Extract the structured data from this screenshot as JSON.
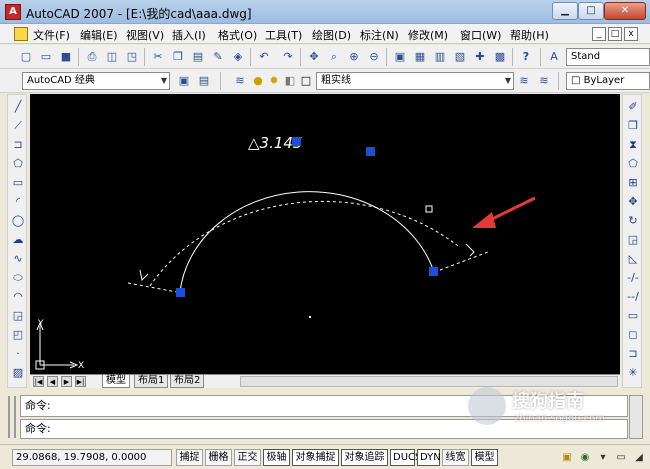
{
  "window": {
    "title": "AutoCAD 2007 - [E:\\我的cad\\aaa.dwg]",
    "min_glyph": "▁",
    "max_glyph": "□",
    "close_glyph": "✕"
  },
  "menu": {
    "items": [
      "文件(F)",
      "编辑(E)",
      "视图(V)",
      "插入(I)",
      "格式(O)",
      "工具(T)",
      "绘图(D)",
      "标注(N)",
      "修改(M)",
      "窗口(W)",
      "帮助(H)"
    ],
    "doc_controls": [
      "_",
      "□",
      "x"
    ]
  },
  "toolbar_standard": {
    "textstyle_value": "Stand"
  },
  "toolbar_layers": {
    "workspace_value": "AutoCAD 经典",
    "layer_value": "粗实线",
    "color_value": "ByLayer"
  },
  "canvas": {
    "ucs_x": "X",
    "ucs_y": "Y",
    "background": "#000000",
    "grip_color": "#1b4fd8",
    "arrow_color": "#e23a3a",
    "dimension_label": "△3.145"
  },
  "layout_tabs": {
    "tabs": [
      "模型",
      "布局1",
      "布局2"
    ],
    "active": "模型"
  },
  "command": {
    "history_line": "命令:",
    "input_line": "命令:"
  },
  "status": {
    "coordinates": "29.0868, 19.7908, 0.0000",
    "buttons": [
      {
        "label": "捕捉",
        "on": false
      },
      {
        "label": "栅格",
        "on": false
      },
      {
        "label": "正交",
        "on": false
      },
      {
        "label": "极轴",
        "on": true
      },
      {
        "label": "对象捕捉",
        "on": true
      },
      {
        "label": "对象追踪",
        "on": true
      },
      {
        "label": "DUCS",
        "on": true
      },
      {
        "label": "DYN",
        "on": true
      },
      {
        "label": "线宽",
        "on": false
      },
      {
        "label": "模型",
        "on": true
      }
    ]
  },
  "watermark": {
    "text": "搜狗指南",
    "url": "zhinan.sogou.com"
  }
}
